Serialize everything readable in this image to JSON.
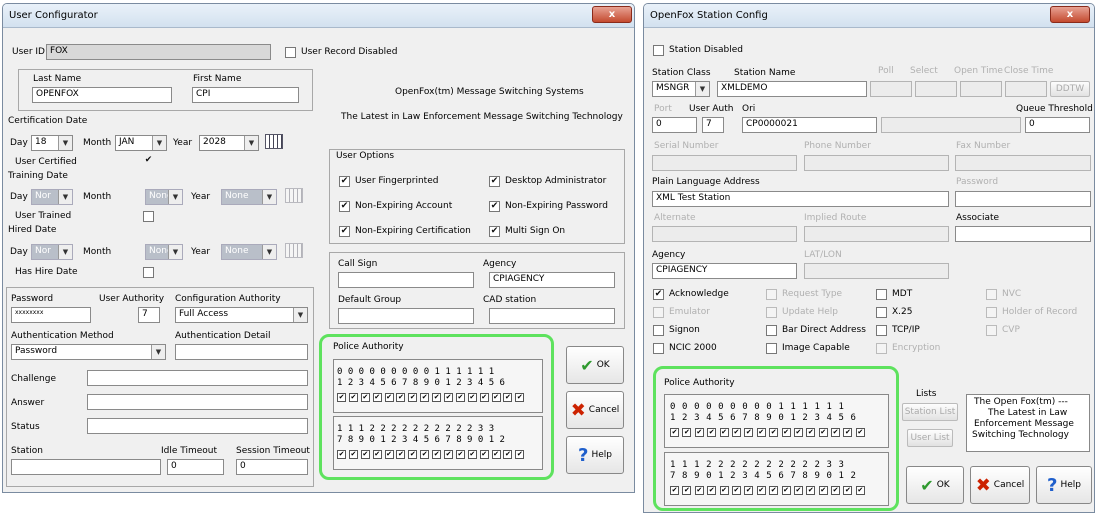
{
  "left_window": {
    "title": "User Configurator",
    "close_label": "x",
    "user_id_label": "User ID",
    "user_id_value": "FOX",
    "user_record_disabled_label": "User Record Disabled",
    "last_name_label": "Last Name",
    "last_name_value": "OPENFOX",
    "first_name_label": "First Name",
    "first_name_value": "CPI",
    "banner_line1": "OpenFox(tm) Message Switching Systems",
    "banner_line2": "The Latest in Law Enforcement Message Switching Technology",
    "cert_date_label": "Certification Date",
    "day_label": "Day",
    "month_label": "Month",
    "year_label": "Year",
    "cert_day": "18",
    "cert_month": "JAN",
    "cert_year": "2028",
    "user_certified_label": "User Certified",
    "user_certified_mark": "✔",
    "training_date_label": "Training Date",
    "none_short": "Nor",
    "none_mid": "None",
    "user_trained_label": "User Trained",
    "hired_date_label": "Hired Date",
    "has_hire_date_label": "Has Hire Date",
    "user_options_label": "User Options",
    "opt_fingerprinted": "User Fingerprinted",
    "opt_desktop_admin": "Desktop Administrator",
    "opt_nonexp_account": "Non-Expiring Account",
    "opt_nonexp_password": "Non-Expiring Password",
    "opt_nonexp_cert": "Non-Expiring Certification",
    "opt_multi_sign_on": "Multi Sign On",
    "check_mark": "✔",
    "call_sign_label": "Call Sign",
    "agency_label": "Agency",
    "agency_value": "CPIAGENCY",
    "default_group_label": "Default Group",
    "cad_station_label": "CAD station",
    "password_label": "Password",
    "password_value": "xxxxxxxx",
    "user_authority_label": "User Authority",
    "user_authority_value": "7",
    "config_authority_label": "Configuration Authority",
    "config_authority_value": "Full Access",
    "auth_method_label": "Authentication Method",
    "auth_method_value": "Password",
    "auth_detail_label": "Authentication Detail",
    "challenge_label": "Challenge",
    "answer_label": "Answer",
    "status_label": "Status",
    "station_label": "Station",
    "idle_timeout_label": "Idle Timeout",
    "idle_timeout_value": "0",
    "session_timeout_label": "Session Timeout",
    "session_timeout_value": "0",
    "police_authority_label": "Police Authority",
    "pa_row1_top": "0 0 0 0 0 0 0 0 0 1 1 1 1 1 1",
    "pa_row1_bot": "1 2 3 4 5 6 7 8 9 0 1 2 3 4 5 6",
    "pa_row2_top": "1 1 1 2 2 2 2 2 2 2 2 2 2 3 3",
    "pa_row2_bot": "7 8 9 0 1 2 3 4 5 6 7 8 9 0 1 2",
    "ok_label": "OK",
    "cancel_label": "Cancel",
    "help_label": "Help"
  },
  "right_window": {
    "title": "OpenFox Station Config",
    "close_label": "x",
    "station_disabled_label": "Station Disabled",
    "station_class_label": "Station Class",
    "station_class_value": "MSNGR",
    "station_name_label": "Station Name",
    "station_name_value": "XMLDEMO",
    "poll_label": "Poll",
    "select_label": "Select",
    "open_time_label": "Open Time",
    "close_time_label": "Close Time",
    "ddtw_label": "DDTW",
    "port_label": "Port",
    "port_value": "0",
    "user_auth_label": "User Auth",
    "user_auth_value": "7",
    "ori_label": "Ori",
    "ori_value": "CP0000021",
    "queue_threshold_label": "Queue Threshold",
    "queue_threshold_value": "0",
    "serial_number_label": "Serial Number",
    "phone_number_label": "Phone Number",
    "fax_number_label": "Fax Number",
    "plain_language_label": "Plain Language Address",
    "plain_language_value": "XML Test Station",
    "password_label": "Password",
    "alternate_label": "Alternate",
    "implied_route_label": "Implied Route",
    "associate_label": "Associate",
    "agency_label": "Agency",
    "agency_value": "CPIAGENCY",
    "lat_lon_label": "LAT/LON",
    "cb_acknowledge": "Acknowledge",
    "cb_request_type": "Request Type",
    "cb_mdt": "MDT",
    "cb_nvc": "NVC",
    "cb_emulator": "Emulator",
    "cb_update_help": "Update Help",
    "cb_x25": "X.25",
    "cb_holder": "Holder of Record",
    "cb_signon": "Signon",
    "cb_bar_direct": "Bar Direct Address",
    "cb_tcpip": "TCP/IP",
    "cb_cvp": "CVP",
    "cb_ncic": "NCIC 2000",
    "cb_image_capable": "Image Capable",
    "cb_encryption": "Encryption",
    "check_mark": "✔",
    "police_authority_label": "Police Authority",
    "pa_row1_top": "0 0 0 0 0 0 0 0 0 1 1 1 1 1 1",
    "pa_row1_bot": "1 2 3 4 5 6 7 8 9 0 1 2 3 4 5 6",
    "pa_row2_top": "1 1 1 2 2 2 2 2 2 2 2 2 2 3 3",
    "pa_row2_bot": "7 8 9 0 1 2 3 4 5 6 7 8 9 0 1 2",
    "lists_label": "Lists",
    "station_list_label": "Station List",
    "user_list_label": "User List",
    "info_line1": "The Open Fox(tm) ---",
    "info_line2": "The Latest in Law",
    "info_line3": "Enforcement Message",
    "info_line4": "Switching Technology",
    "ok_label": "OK",
    "cancel_label": "Cancel",
    "help_label": "Help"
  },
  "colors": {
    "highlight": "#5ee25e",
    "title_bar": "#dbe6f1",
    "close_button": "#c44a2f"
  }
}
